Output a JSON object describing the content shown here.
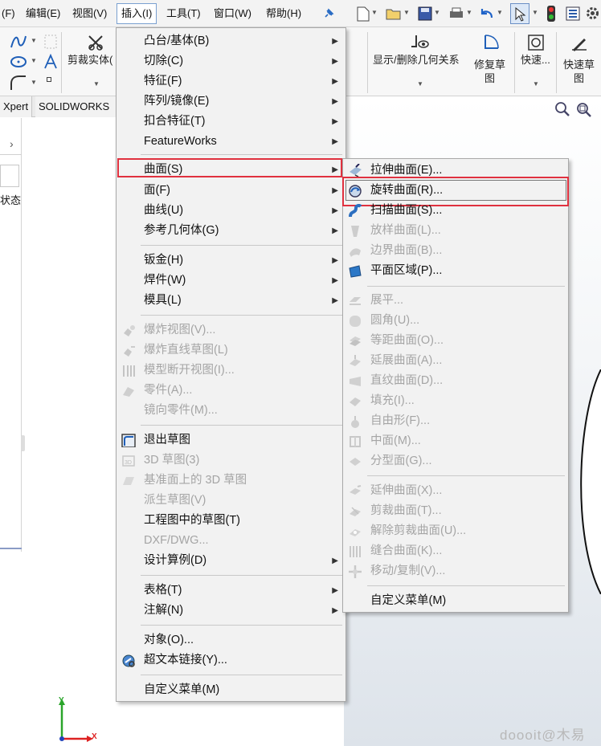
{
  "menubar": {
    "items": [
      "(F)",
      "编辑(E)",
      "视图(V)",
      "插入(I)",
      "工具(T)",
      "窗口(W)",
      "帮助(H)"
    ],
    "active": "插入(I)"
  },
  "ribbon": {
    "trim_entity": "剪裁实体(",
    "show_delete_relations": "显示/删除几何关系",
    "repair_sketch": [
      "修复草",
      "图"
    ],
    "quick_snap": "快速...",
    "rapid_sketch": [
      "快速草",
      "图"
    ]
  },
  "tabs": [
    "Xpert",
    "SOLIDWORKS"
  ],
  "left_panel": {
    "status_label": "状态"
  },
  "insert_menu": {
    "items": [
      {
        "label": "凸台/基体(B)",
        "submenu": true,
        "disabled": false,
        "icon": ""
      },
      {
        "label": "切除(C)",
        "submenu": true,
        "disabled": false,
        "icon": ""
      },
      {
        "label": "特征(F)",
        "submenu": true,
        "disabled": false,
        "icon": ""
      },
      {
        "label": "阵列/镜像(E)",
        "submenu": true,
        "disabled": false,
        "icon": ""
      },
      {
        "label": "扣合特征(T)",
        "submenu": true,
        "disabled": false,
        "icon": ""
      },
      {
        "label": "FeatureWorks",
        "submenu": true,
        "disabled": false,
        "icon": ""
      },
      {
        "label": "曲面(S)",
        "submenu": true,
        "disabled": false,
        "icon": "",
        "highlight": true
      },
      {
        "label": "面(F)",
        "submenu": true,
        "disabled": false,
        "icon": ""
      },
      {
        "label": "曲线(U)",
        "submenu": true,
        "disabled": false,
        "icon": ""
      },
      {
        "label": "参考几何体(G)",
        "submenu": true,
        "disabled": false,
        "icon": ""
      },
      {
        "label": "钣金(H)",
        "submenu": true,
        "disabled": false,
        "icon": ""
      },
      {
        "label": "焊件(W)",
        "submenu": true,
        "disabled": false,
        "icon": ""
      },
      {
        "label": "模具(L)",
        "submenu": true,
        "disabled": false,
        "icon": ""
      },
      {
        "label": "爆炸视图(V)...",
        "submenu": false,
        "disabled": true,
        "icon": "explode-icon"
      },
      {
        "label": "爆炸直线草图(L)",
        "submenu": false,
        "disabled": true,
        "icon": "explode-line-icon"
      },
      {
        "label": "模型断开视图(I)...",
        "submenu": false,
        "disabled": true,
        "icon": "break-view-icon"
      },
      {
        "label": "零件(A)...",
        "submenu": false,
        "disabled": true,
        "icon": "part-icon"
      },
      {
        "label": "镜向零件(M)...",
        "submenu": false,
        "disabled": true,
        "icon": ""
      },
      {
        "label": "退出草图",
        "submenu": false,
        "disabled": false,
        "icon": "exit-sketch-icon"
      },
      {
        "label": "3D 草图(3)",
        "submenu": false,
        "disabled": true,
        "icon": "sketch-3d-icon"
      },
      {
        "label": "基准面上的 3D 草图",
        "submenu": false,
        "disabled": true,
        "icon": "sketch-3d-plane-icon"
      },
      {
        "label": "派生草图(V)",
        "submenu": false,
        "disabled": true,
        "icon": ""
      },
      {
        "label": "工程图中的草图(T)",
        "submenu": false,
        "disabled": false,
        "icon": ""
      },
      {
        "label": "DXF/DWG...",
        "submenu": false,
        "disabled": true,
        "icon": ""
      },
      {
        "label": "设计算例(D)",
        "submenu": true,
        "disabled": false,
        "icon": ""
      },
      {
        "label": "表格(T)",
        "submenu": true,
        "disabled": false,
        "icon": ""
      },
      {
        "label": "注解(N)",
        "submenu": true,
        "disabled": false,
        "icon": ""
      },
      {
        "label": "对象(O)...",
        "submenu": false,
        "disabled": false,
        "icon": ""
      },
      {
        "label": "超文本链接(Y)...",
        "submenu": false,
        "disabled": false,
        "icon": "hyperlink-icon"
      },
      {
        "label": "自定义菜单(M)",
        "submenu": false,
        "disabled": false,
        "icon": ""
      }
    ]
  },
  "surface_menu": {
    "items": [
      {
        "label": "拉伸曲面(E)...",
        "disabled": false,
        "icon": "extruded-surface-icon"
      },
      {
        "label": "旋转曲面(R)...",
        "disabled": false,
        "icon": "revolved-surface-icon",
        "highlight": true
      },
      {
        "label": "扫描曲面(S)...",
        "disabled": false,
        "icon": "swept-surface-icon"
      },
      {
        "label": "放样曲面(L)...",
        "disabled": true,
        "icon": "lofted-surface-icon"
      },
      {
        "label": "边界曲面(B)...",
        "disabled": true,
        "icon": "boundary-surface-icon"
      },
      {
        "label": "平面区域(P)...",
        "disabled": false,
        "icon": "planar-surface-icon"
      },
      {
        "label": "展平...",
        "disabled": true,
        "icon": "flatten-icon"
      },
      {
        "label": "圆角(U)...",
        "disabled": true,
        "icon": "fillet-icon"
      },
      {
        "label": "等距曲面(O)...",
        "disabled": true,
        "icon": "offset-surface-icon"
      },
      {
        "label": "延展曲面(A)...",
        "disabled": true,
        "icon": "radiate-surface-icon"
      },
      {
        "label": "直纹曲面(D)...",
        "disabled": true,
        "icon": "ruled-surface-icon"
      },
      {
        "label": "填充(I)...",
        "disabled": true,
        "icon": "fill-surface-icon"
      },
      {
        "label": "自由形(F)...",
        "disabled": true,
        "icon": "freeform-icon"
      },
      {
        "label": "中面(M)...",
        "disabled": true,
        "icon": "mid-surface-icon"
      },
      {
        "label": "分型面(G)...",
        "disabled": true,
        "icon": "parting-surface-icon"
      },
      {
        "label": "延伸曲面(X)...",
        "disabled": true,
        "icon": "extend-surface-icon"
      },
      {
        "label": "剪裁曲面(T)...",
        "disabled": true,
        "icon": "trim-surface-icon"
      },
      {
        "label": "解除剪裁曲面(U)...",
        "disabled": true,
        "icon": "untrim-surface-icon"
      },
      {
        "label": "缝合曲面(K)...",
        "disabled": true,
        "icon": "knit-surface-icon"
      },
      {
        "label": "移动/复制(V)...",
        "disabled": true,
        "icon": "move-copy-icon"
      },
      {
        "label": "自定义菜单(M)",
        "disabled": false,
        "icon": ""
      }
    ]
  },
  "axes": {
    "y": "Y",
    "x": "X"
  },
  "watermark": "doooit@木易"
}
